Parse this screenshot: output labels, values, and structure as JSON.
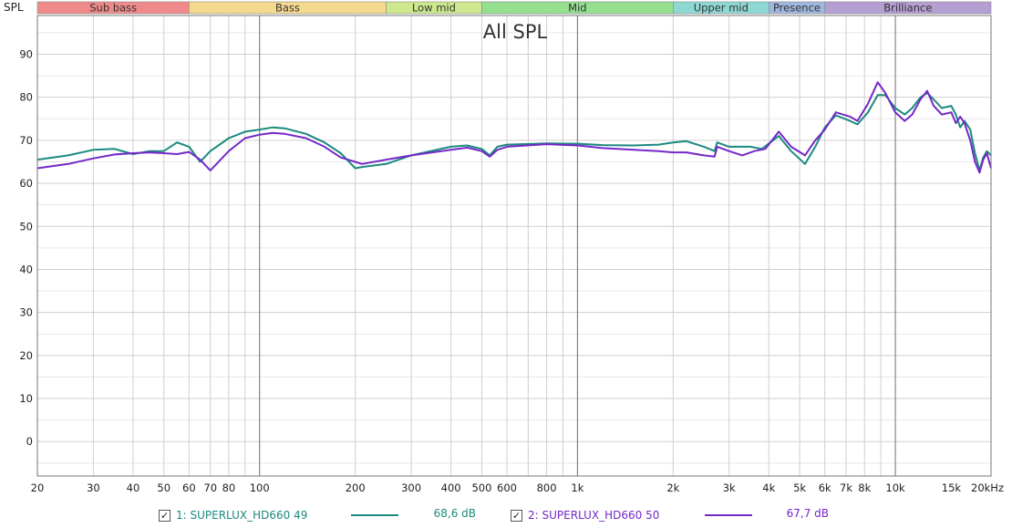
{
  "chart_data": {
    "type": "line",
    "title": "All SPL",
    "ylabel": "SPL",
    "xscale": "log",
    "xlim": [
      20,
      20000
    ],
    "ylim": [
      -8,
      99
    ],
    "y_ticks": [
      0,
      10,
      20,
      30,
      40,
      50,
      60,
      70,
      80,
      90
    ],
    "x_ticks": [
      {
        "v": 20,
        "label": "20"
      },
      {
        "v": 30,
        "label": "30"
      },
      {
        "v": 40,
        "label": "40"
      },
      {
        "v": 50,
        "label": "50"
      },
      {
        "v": 60,
        "label": "60"
      },
      {
        "v": 70,
        "label": "70"
      },
      {
        "v": 80,
        "label": "80"
      },
      {
        "v": 100,
        "label": "100"
      },
      {
        "v": 200,
        "label": "200"
      },
      {
        "v": 300,
        "label": "300"
      },
      {
        "v": 400,
        "label": "400"
      },
      {
        "v": 500,
        "label": "500"
      },
      {
        "v": 600,
        "label": "600"
      },
      {
        "v": 800,
        "label": "800"
      },
      {
        "v": 1000,
        "label": "1k"
      },
      {
        "v": 2000,
        "label": "2k"
      },
      {
        "v": 3000,
        "label": "3k"
      },
      {
        "v": 4000,
        "label": "4k"
      },
      {
        "v": 5000,
        "label": "5k"
      },
      {
        "v": 6000,
        "label": "6k"
      },
      {
        "v": 7000,
        "label": "7k"
      },
      {
        "v": 8000,
        "label": "8k"
      },
      {
        "v": 10000,
        "label": "10k"
      },
      {
        "v": 15000,
        "label": "15k"
      },
      {
        "v": 20000,
        "label": "20kHz"
      }
    ],
    "bands": [
      {
        "name": "Sub bass",
        "from": 20,
        "to": 60,
        "color": "#f08a8a"
      },
      {
        "name": "Bass",
        "from": 60,
        "to": 250,
        "color": "#f5d98e"
      },
      {
        "name": "Low mid",
        "from": 250,
        "to": 500,
        "color": "#cde88e"
      },
      {
        "name": "Mid",
        "from": 500,
        "to": 2000,
        "color": "#94e08e"
      },
      {
        "name": "Upper mid",
        "from": 2000,
        "to": 4000,
        "color": "#8ed8d4"
      },
      {
        "name": "Presence",
        "from": 4000,
        "to": 6000,
        "color": "#9eb6e0"
      },
      {
        "name": "Brilliance",
        "from": 6000,
        "to": 20000,
        "color": "#b49ed2"
      }
    ],
    "series": [
      {
        "name": "1: SUPERLUX_HD660 49",
        "color": "#1b8a7f",
        "value_label": "68,6 dB",
        "checked": "✓",
        "points": [
          [
            20,
            65.5
          ],
          [
            25,
            66.5
          ],
          [
            30,
            67.8
          ],
          [
            35,
            68.0
          ],
          [
            40,
            66.8
          ],
          [
            45,
            67.5
          ],
          [
            50,
            67.5
          ],
          [
            55,
            69.5
          ],
          [
            60,
            68.5
          ],
          [
            65,
            65.0
          ],
          [
            70,
            67.5
          ],
          [
            80,
            70.5
          ],
          [
            90,
            72.0
          ],
          [
            100,
            72.5
          ],
          [
            110,
            73.0
          ],
          [
            120,
            72.8
          ],
          [
            140,
            71.5
          ],
          [
            160,
            69.5
          ],
          [
            180,
            67.0
          ],
          [
            200,
            63.5
          ],
          [
            210,
            63.8
          ],
          [
            250,
            64.5
          ],
          [
            300,
            66.5
          ],
          [
            400,
            68.5
          ],
          [
            450,
            68.8
          ],
          [
            500,
            68.0
          ],
          [
            530,
            66.5
          ],
          [
            560,
            68.5
          ],
          [
            600,
            69.0
          ],
          [
            800,
            69.3
          ],
          [
            1000,
            69.2
          ],
          [
            1200,
            68.9
          ],
          [
            1500,
            68.8
          ],
          [
            1800,
            69.0
          ],
          [
            2000,
            69.5
          ],
          [
            2200,
            69.8
          ],
          [
            2500,
            68.5
          ],
          [
            2700,
            67.5
          ],
          [
            2750,
            69.5
          ],
          [
            3000,
            68.5
          ],
          [
            3500,
            68.5
          ],
          [
            3800,
            68.0
          ],
          [
            4300,
            71.0
          ],
          [
            4700,
            67.5
          ],
          [
            5200,
            64.5
          ],
          [
            5600,
            68.5
          ],
          [
            6000,
            73.0
          ],
          [
            6500,
            75.8
          ],
          [
            7200,
            74.5
          ],
          [
            7600,
            73.7
          ],
          [
            8200,
            76.5
          ],
          [
            8800,
            80.5
          ],
          [
            9300,
            80.5
          ],
          [
            10000,
            77.5
          ],
          [
            10700,
            76.0
          ],
          [
            11300,
            77.5
          ],
          [
            12000,
            80.0
          ],
          [
            12600,
            81.0
          ],
          [
            13200,
            79.5
          ],
          [
            14000,
            77.5
          ],
          [
            15000,
            78.0
          ],
          [
            15500,
            76.0
          ],
          [
            16000,
            73.0
          ],
          [
            16500,
            74.5
          ],
          [
            17200,
            72.5
          ],
          [
            17800,
            67.0
          ],
          [
            18400,
            63.0
          ],
          [
            18900,
            66.0
          ],
          [
            19400,
            67.5
          ],
          [
            20000,
            66.5
          ]
        ]
      },
      {
        "name": "2: SUPERLUX_HD660 50",
        "color": "#7428c8",
        "value_label": "67,7 dB",
        "checked": "✓",
        "points": [
          [
            20,
            63.5
          ],
          [
            25,
            64.5
          ],
          [
            30,
            65.8
          ],
          [
            35,
            66.7
          ],
          [
            40,
            67.0
          ],
          [
            45,
            67.2
          ],
          [
            50,
            67.0
          ],
          [
            55,
            66.8
          ],
          [
            60,
            67.3
          ],
          [
            65,
            65.5
          ],
          [
            70,
            63.0
          ],
          [
            80,
            67.5
          ],
          [
            90,
            70.5
          ],
          [
            100,
            71.3
          ],
          [
            110,
            71.7
          ],
          [
            120,
            71.5
          ],
          [
            140,
            70.5
          ],
          [
            160,
            68.5
          ],
          [
            180,
            66.0
          ],
          [
            200,
            65.0
          ],
          [
            210,
            64.5
          ],
          [
            250,
            65.5
          ],
          [
            300,
            66.5
          ],
          [
            400,
            67.8
          ],
          [
            450,
            68.3
          ],
          [
            500,
            67.5
          ],
          [
            530,
            66.2
          ],
          [
            560,
            67.8
          ],
          [
            600,
            68.5
          ],
          [
            800,
            69.1
          ],
          [
            1000,
            68.8
          ],
          [
            1200,
            68.2
          ],
          [
            1500,
            67.8
          ],
          [
            1800,
            67.5
          ],
          [
            2000,
            67.2
          ],
          [
            2200,
            67.2
          ],
          [
            2500,
            66.5
          ],
          [
            2700,
            66.2
          ],
          [
            2750,
            68.5
          ],
          [
            3000,
            67.5
          ],
          [
            3300,
            66.5
          ],
          [
            3600,
            67.5
          ],
          [
            3900,
            68.0
          ],
          [
            4300,
            72.0
          ],
          [
            4700,
            68.5
          ],
          [
            5200,
            66.5
          ],
          [
            5600,
            70.0
          ],
          [
            6000,
            72.5
          ],
          [
            6500,
            76.5
          ],
          [
            7200,
            75.5
          ],
          [
            7600,
            74.5
          ],
          [
            8200,
            78.5
          ],
          [
            8800,
            83.5
          ],
          [
            9300,
            81.0
          ],
          [
            10000,
            76.5
          ],
          [
            10700,
            74.5
          ],
          [
            11300,
            76.0
          ],
          [
            12000,
            79.5
          ],
          [
            12600,
            81.5
          ],
          [
            13200,
            78.0
          ],
          [
            14000,
            76.0
          ],
          [
            15000,
            76.5
          ],
          [
            15500,
            74.0
          ],
          [
            16000,
            75.5
          ],
          [
            16500,
            74.0
          ],
          [
            17200,
            70.0
          ],
          [
            17800,
            65.0
          ],
          [
            18400,
            62.5
          ],
          [
            18900,
            65.5
          ],
          [
            19400,
            67.0
          ],
          [
            20000,
            63.5
          ]
        ]
      }
    ]
  }
}
